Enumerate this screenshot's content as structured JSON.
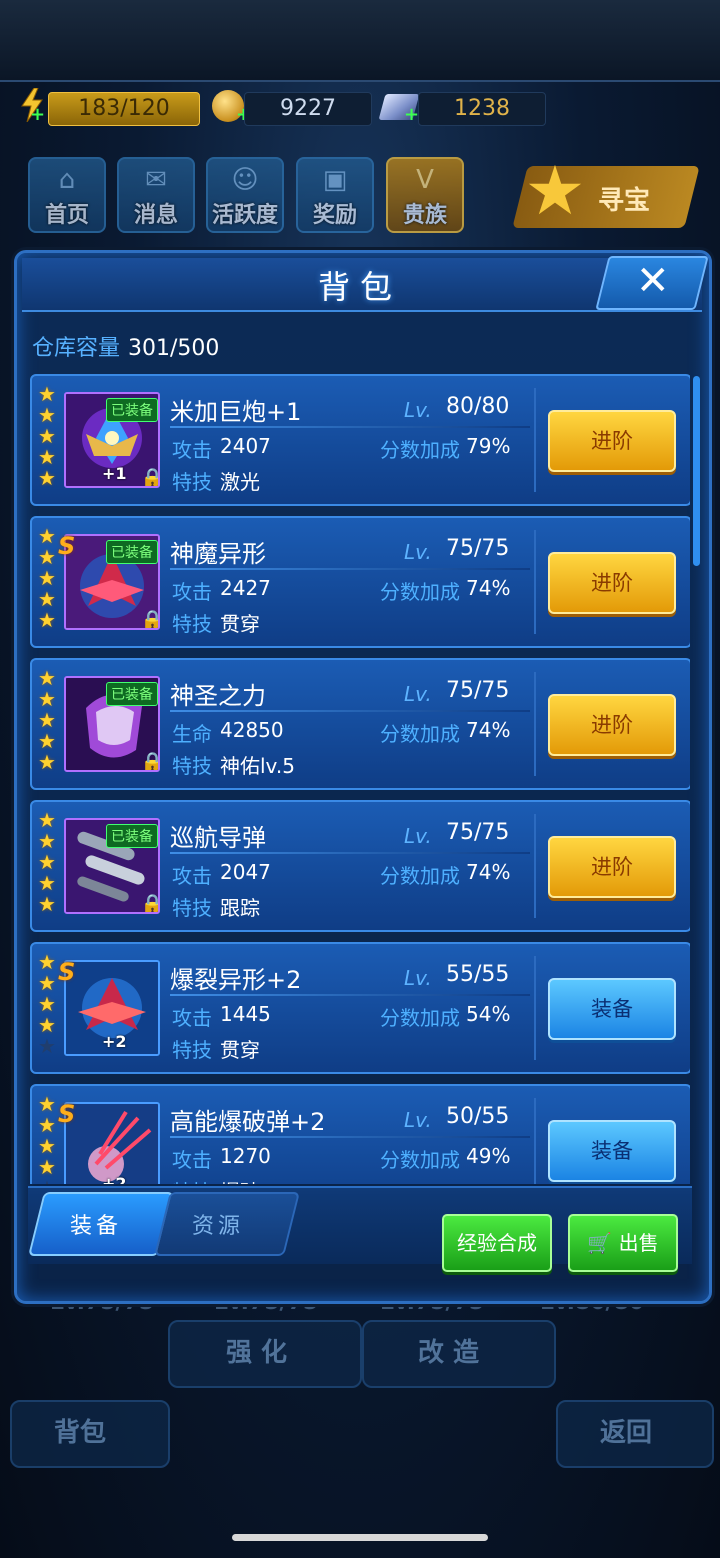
{
  "resources": {
    "energy": "183/120",
    "coins": "9227",
    "gems": "1238"
  },
  "nav": [
    {
      "label": "首页"
    },
    {
      "label": "消息"
    },
    {
      "label": "活跃度"
    },
    {
      "label": "奖励"
    },
    {
      "label": "贵族"
    }
  ],
  "treasure_label": "寻宝",
  "panel": {
    "title": "背包",
    "capacity_label": "仓库容量",
    "capacity_value": "301/500"
  },
  "items": [
    {
      "name": "米加巨炮+1",
      "lv_label": "Lv.",
      "lv": "80/80",
      "stat_label": "攻击",
      "stat": "2407",
      "bonus_label": "分数加成",
      "bonus": "79%",
      "skill_label": "特技",
      "skill": "激光",
      "equipped": "已装备",
      "plus": "+1",
      "action": "进阶",
      "stars": 5,
      "s_rank": ""
    },
    {
      "name": "神魔异形",
      "lv_label": "Lv.",
      "lv": "75/75",
      "stat_label": "攻击",
      "stat": "2427",
      "bonus_label": "分数加成",
      "bonus": "74%",
      "skill_label": "特技",
      "skill": "贯穿",
      "equipped": "已装备",
      "plus": "",
      "action": "进阶",
      "stars": 5,
      "s_rank": "S"
    },
    {
      "name": "神圣之力",
      "lv_label": "Lv.",
      "lv": "75/75",
      "stat_label": "生命",
      "stat": "42850",
      "bonus_label": "分数加成",
      "bonus": "74%",
      "skill_label": "特技",
      "skill": "神佑lv.5",
      "equipped": "已装备",
      "plus": "",
      "action": "进阶",
      "stars": 5,
      "s_rank": ""
    },
    {
      "name": "巡航导弹",
      "lv_label": "Lv.",
      "lv": "75/75",
      "stat_label": "攻击",
      "stat": "2047",
      "bonus_label": "分数加成",
      "bonus": "74%",
      "skill_label": "特技",
      "skill": "跟踪",
      "equipped": "已装备",
      "plus": "",
      "action": "进阶",
      "stars": 5,
      "s_rank": ""
    },
    {
      "name": "爆裂异形+2",
      "lv_label": "Lv.",
      "lv": "55/55",
      "stat_label": "攻击",
      "stat": "1445",
      "bonus_label": "分数加成",
      "bonus": "54%",
      "skill_label": "特技",
      "skill": "贯穿",
      "equipped": "",
      "plus": "+2",
      "action": "装备",
      "stars": 4,
      "s_rank": "S"
    },
    {
      "name": "高能爆破弹+2",
      "lv_label": "Lv.",
      "lv": "50/55",
      "stat_label": "攻击",
      "stat": "1270",
      "bonus_label": "分数加成",
      "bonus": "49%",
      "skill_label": "特技",
      "skill": "爆破",
      "equipped": "",
      "plus": "+2",
      "action": "装备",
      "stars": 4,
      "s_rank": "S"
    }
  ],
  "tabs": {
    "equipment": "装备",
    "resources": "资源"
  },
  "buttons": {
    "exp_merge": "经验合成",
    "sell": "出售"
  },
  "background": {
    "lv_ghosts": [
      "Lv.75/75",
      "Lv.75/75",
      "Lv.75/75",
      "Lv.80/80"
    ],
    "strengthen": "强 化",
    "modify": "改 造",
    "backpack": "背包",
    "return": "返回"
  },
  "colors": {
    "panel_blue": "#0c2b56",
    "gold_button": "#ffd640",
    "blue_button": "#5cc8ff",
    "green_button": "#4bea40"
  }
}
